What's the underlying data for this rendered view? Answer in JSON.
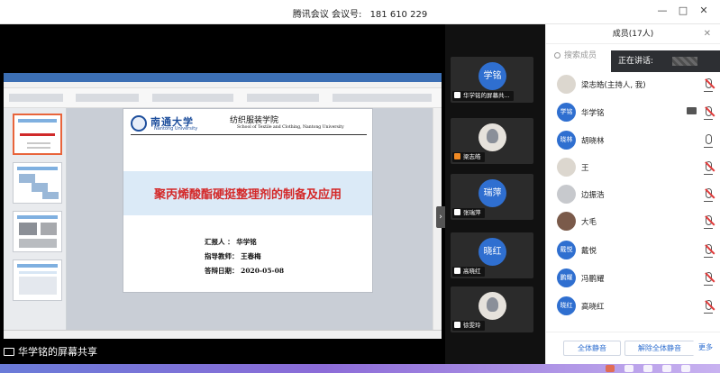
{
  "window": {
    "app_name": "腾讯会议",
    "meeting_label": "会议号:",
    "meeting_id": "181 610 229",
    "minimize": "—",
    "maximize": "□",
    "close": "✕"
  },
  "main": {
    "share_caption": "华学铭的屏幕共享",
    "collapse_arrow": "›",
    "slide": {
      "univ_cn": "南通大学",
      "univ_en": "Nantong University",
      "school_cn": "纺织服装学院",
      "school_en": "School of Textile and Clothing, Nantong University",
      "title": "聚丙烯酸酯硬挺整理剂的制备及应用",
      "reporter": "汇报人 ： 华学铭",
      "advisor": "指导教师： 王春梅",
      "date": "答辩日期： 2020-05-08"
    }
  },
  "tiles": [
    {
      "avatar": "学铭",
      "label": "华学铭的屏幕共...",
      "type": "color"
    },
    {
      "avatar": "",
      "label": "梁志皓",
      "type": "image"
    },
    {
      "avatar": "瑞萍",
      "label": "张瑞萍",
      "type": "color"
    },
    {
      "avatar": "晓红",
      "label": "高晓红",
      "type": "color"
    },
    {
      "avatar": "",
      "label": "徐雯玲",
      "type": "image"
    }
  ],
  "panel": {
    "title": "成员(17人)",
    "close": "✕",
    "search_placeholder": "搜索成员",
    "speaking_label": "正在讲话:",
    "members": [
      {
        "avatar": "",
        "name": "梁志皓(主持人, 我)",
        "kind": "img",
        "mic": "off",
        "screen": false
      },
      {
        "avatar": "学铭",
        "name": "华学铭",
        "kind": "blue",
        "mic": "off",
        "screen": true
      },
      {
        "avatar": "晓林",
        "name": "胡晓林",
        "kind": "blue",
        "mic": "on",
        "screen": false
      },
      {
        "avatar": "",
        "name": "王",
        "kind": "img",
        "mic": "off",
        "screen": false
      },
      {
        "avatar": "",
        "name": "边振浩",
        "kind": "gray",
        "mic": "off",
        "screen": false
      },
      {
        "avatar": "",
        "name": "大毛",
        "kind": "dark",
        "mic": "off",
        "screen": false
      },
      {
        "avatar": "戴悦",
        "name": "戴悦",
        "kind": "blue",
        "mic": "off",
        "screen": false
      },
      {
        "avatar": "鹏耀",
        "name": "冯鹏耀",
        "kind": "blue",
        "mic": "off",
        "screen": false
      },
      {
        "avatar": "晓红",
        "name": "高晓红",
        "kind": "blue",
        "mic": "off",
        "screen": false
      }
    ],
    "mute_all": "全体静音",
    "unmute_all": "解除全体静音",
    "more": "更多"
  },
  "colors": {
    "accent": "#2f6fd0",
    "slide_title": "#d42828",
    "mic_off": "#e03a3a"
  }
}
